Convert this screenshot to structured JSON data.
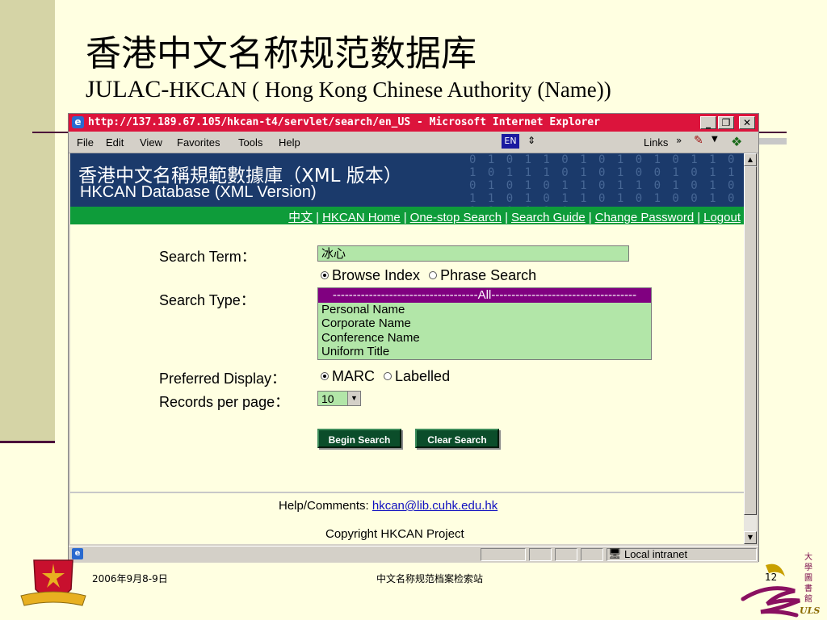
{
  "slide": {
    "title_zh": "香港中文名称规范数据库",
    "title_en_prefix": "JULAC-",
    "title_en_rest": "HKCAN ( Hong Kong Chinese Authority (Name))",
    "footer_date": "2006年9月8-9日",
    "footer_center": "中文名称规范档案检索站",
    "page_number": "12",
    "logo_text": "ULS",
    "logo_vertical_text": "大學圖書館"
  },
  "browser": {
    "window_title": "http://137.189.67.105/hkcan-t4/servlet/search/en_US - Microsoft Internet Explorer",
    "menu": [
      "File",
      "Edit",
      "View",
      "Favorites",
      "Tools",
      "Help"
    ],
    "language_indicator": "EN",
    "links_label": "Links",
    "status_zone": "Local intranet"
  },
  "page": {
    "banner_zh": "香港中文名稱規範數據庫（XML 版本）",
    "banner_en": "HKCAN Database (XML Version)",
    "nav": [
      "中文",
      "HKCAN Home",
      "One-stop Search",
      "Search Guide",
      "Change Password",
      "Logout"
    ],
    "search_term_label": "Search Term：",
    "search_term_value": "冰心",
    "search_modes": [
      "Browse Index",
      "Phrase Search"
    ],
    "search_mode_selected": 0,
    "search_type_label": "Search Type：",
    "search_type_options": [
      "------------------------------------All------------------------------------",
      "Personal Name",
      "Corporate Name",
      "Conference Name",
      "Uniform Title"
    ],
    "preferred_display_label": "Preferred Display：",
    "display_options": [
      "MARC",
      "Labelled"
    ],
    "display_selected": 0,
    "records_per_page_label": "Records per page：",
    "records_per_page_value": "10",
    "begin_search_label": "Begin Search",
    "clear_search_label": "Clear Search",
    "help_label": "Help/Comments:",
    "help_email": "hkcan@lib.cuhk.edu.hk",
    "copyright": "Copyright HKCAN Project"
  },
  "colors": {
    "slide_bg": "#FFFFE1",
    "left_band": "#D5D4A6",
    "titlebar": "#DC143C",
    "banner": "#1B3A6B",
    "navbar": "#0E9C3A",
    "input_bg": "#B2E6A8",
    "button_bg": "#0B4D2A",
    "select_highlight": "#800080"
  }
}
